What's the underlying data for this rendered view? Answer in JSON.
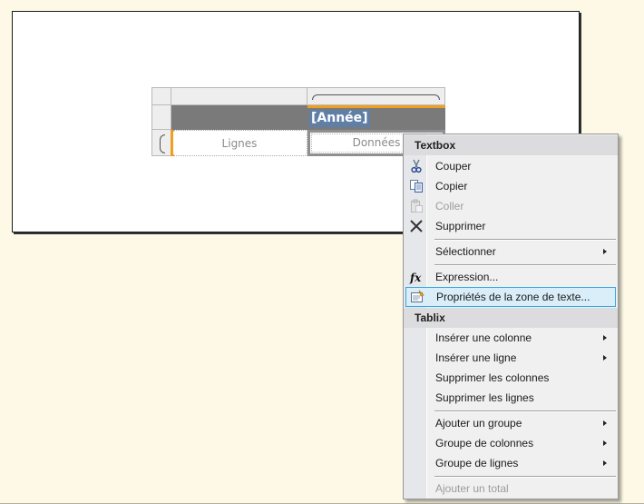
{
  "report": {
    "annee_label": "[Année]",
    "lignes_label": "Lignes",
    "donnees_label": "Données"
  },
  "context_menu": {
    "textbox_header": "Textbox",
    "couper": "Couper",
    "copier": "Copier",
    "coller": "Coller",
    "supprimer": "Supprimer",
    "selectionner": "Sélectionner",
    "expression": "Expression...",
    "proprietes": "Propriétés de la zone de texte...",
    "tablix_header": "Tablix",
    "inserer_colonne": "Insérer une colonne",
    "inserer_ligne": "Insérer une ligne",
    "supprimer_colonnes": "Supprimer les colonnes",
    "supprimer_lignes": "Supprimer les lignes",
    "ajouter_groupe": "Ajouter un groupe",
    "groupe_colonnes": "Groupe de colonnes",
    "groupe_lignes": "Groupe de lignes",
    "ajouter_total": "Ajouter un total",
    "icons": {
      "cut": "scissors-icon",
      "copy": "copy-icon",
      "paste": "paste-icon",
      "delete": "delete-x-icon",
      "expression": "fx-icon",
      "properties": "properties-icon"
    }
  },
  "colors": {
    "background": "#fdf9e6",
    "selection_orange": "#f0a020",
    "highlight_bg": "#d9eef9",
    "highlight_border": "#33a6e0",
    "cell_gray": "#7a7a7a"
  }
}
